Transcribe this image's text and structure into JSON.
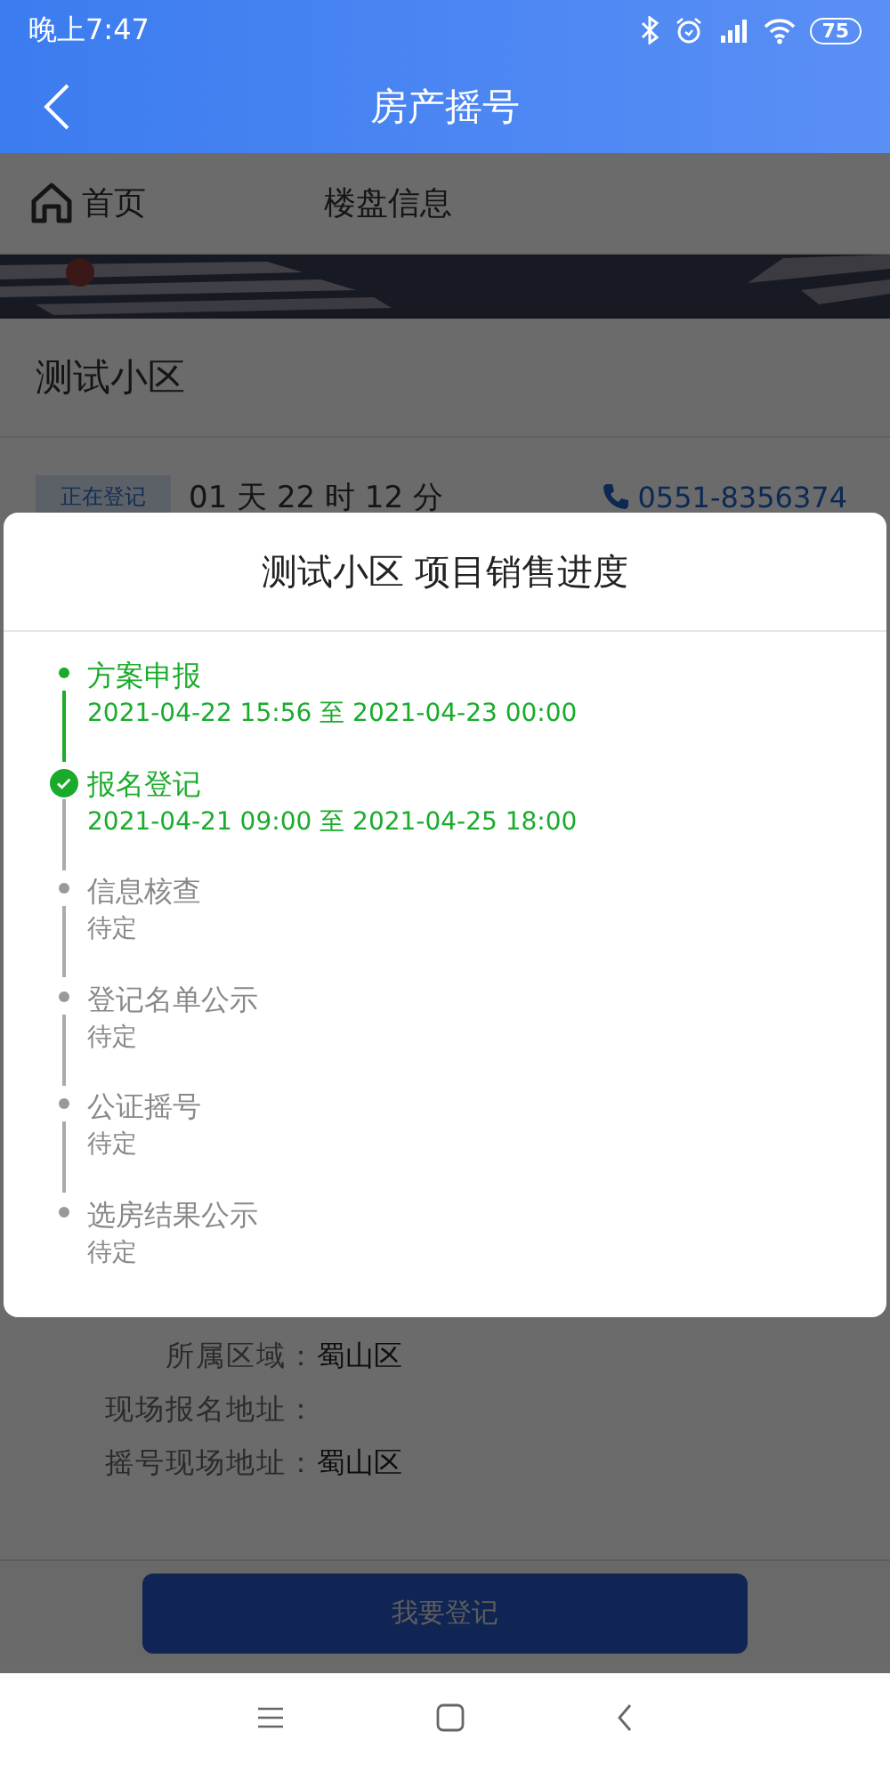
{
  "status_bar": {
    "time": "晚上7:47",
    "battery": "75"
  },
  "header": {
    "title": "房产摇号"
  },
  "nav": {
    "home": "首页",
    "title": "楼盘信息"
  },
  "project": {
    "name": "测试小区",
    "badge": "正在登记",
    "countdown": "01 天 22 时 12 分",
    "phone": "0551-8356374"
  },
  "info": [
    {
      "label": "所属区域：",
      "value": "蜀山区"
    },
    {
      "label": "现场报名地址："
    },
    {
      "label": "摇号现场地址：",
      "value": "蜀山区"
    }
  ],
  "register_button": "我要登记",
  "dialog": {
    "title": "测试小区 项目销售进度",
    "steps": [
      {
        "name": "方案申报",
        "time": "2021-04-22 15:56 至 2021-04-23 00:00",
        "kind": "done"
      },
      {
        "name": "报名登记",
        "time": "2021-04-21 09:00 至 2021-04-25 18:00",
        "kind": "current"
      },
      {
        "name": "信息核查",
        "time": "待定",
        "kind": "pending"
      },
      {
        "name": "登记名单公示",
        "time": "待定",
        "kind": "pending"
      },
      {
        "name": "公证摇号",
        "time": "待定",
        "kind": "pending"
      },
      {
        "name": "选房结果公示",
        "time": "待定",
        "kind": "pending"
      }
    ]
  }
}
